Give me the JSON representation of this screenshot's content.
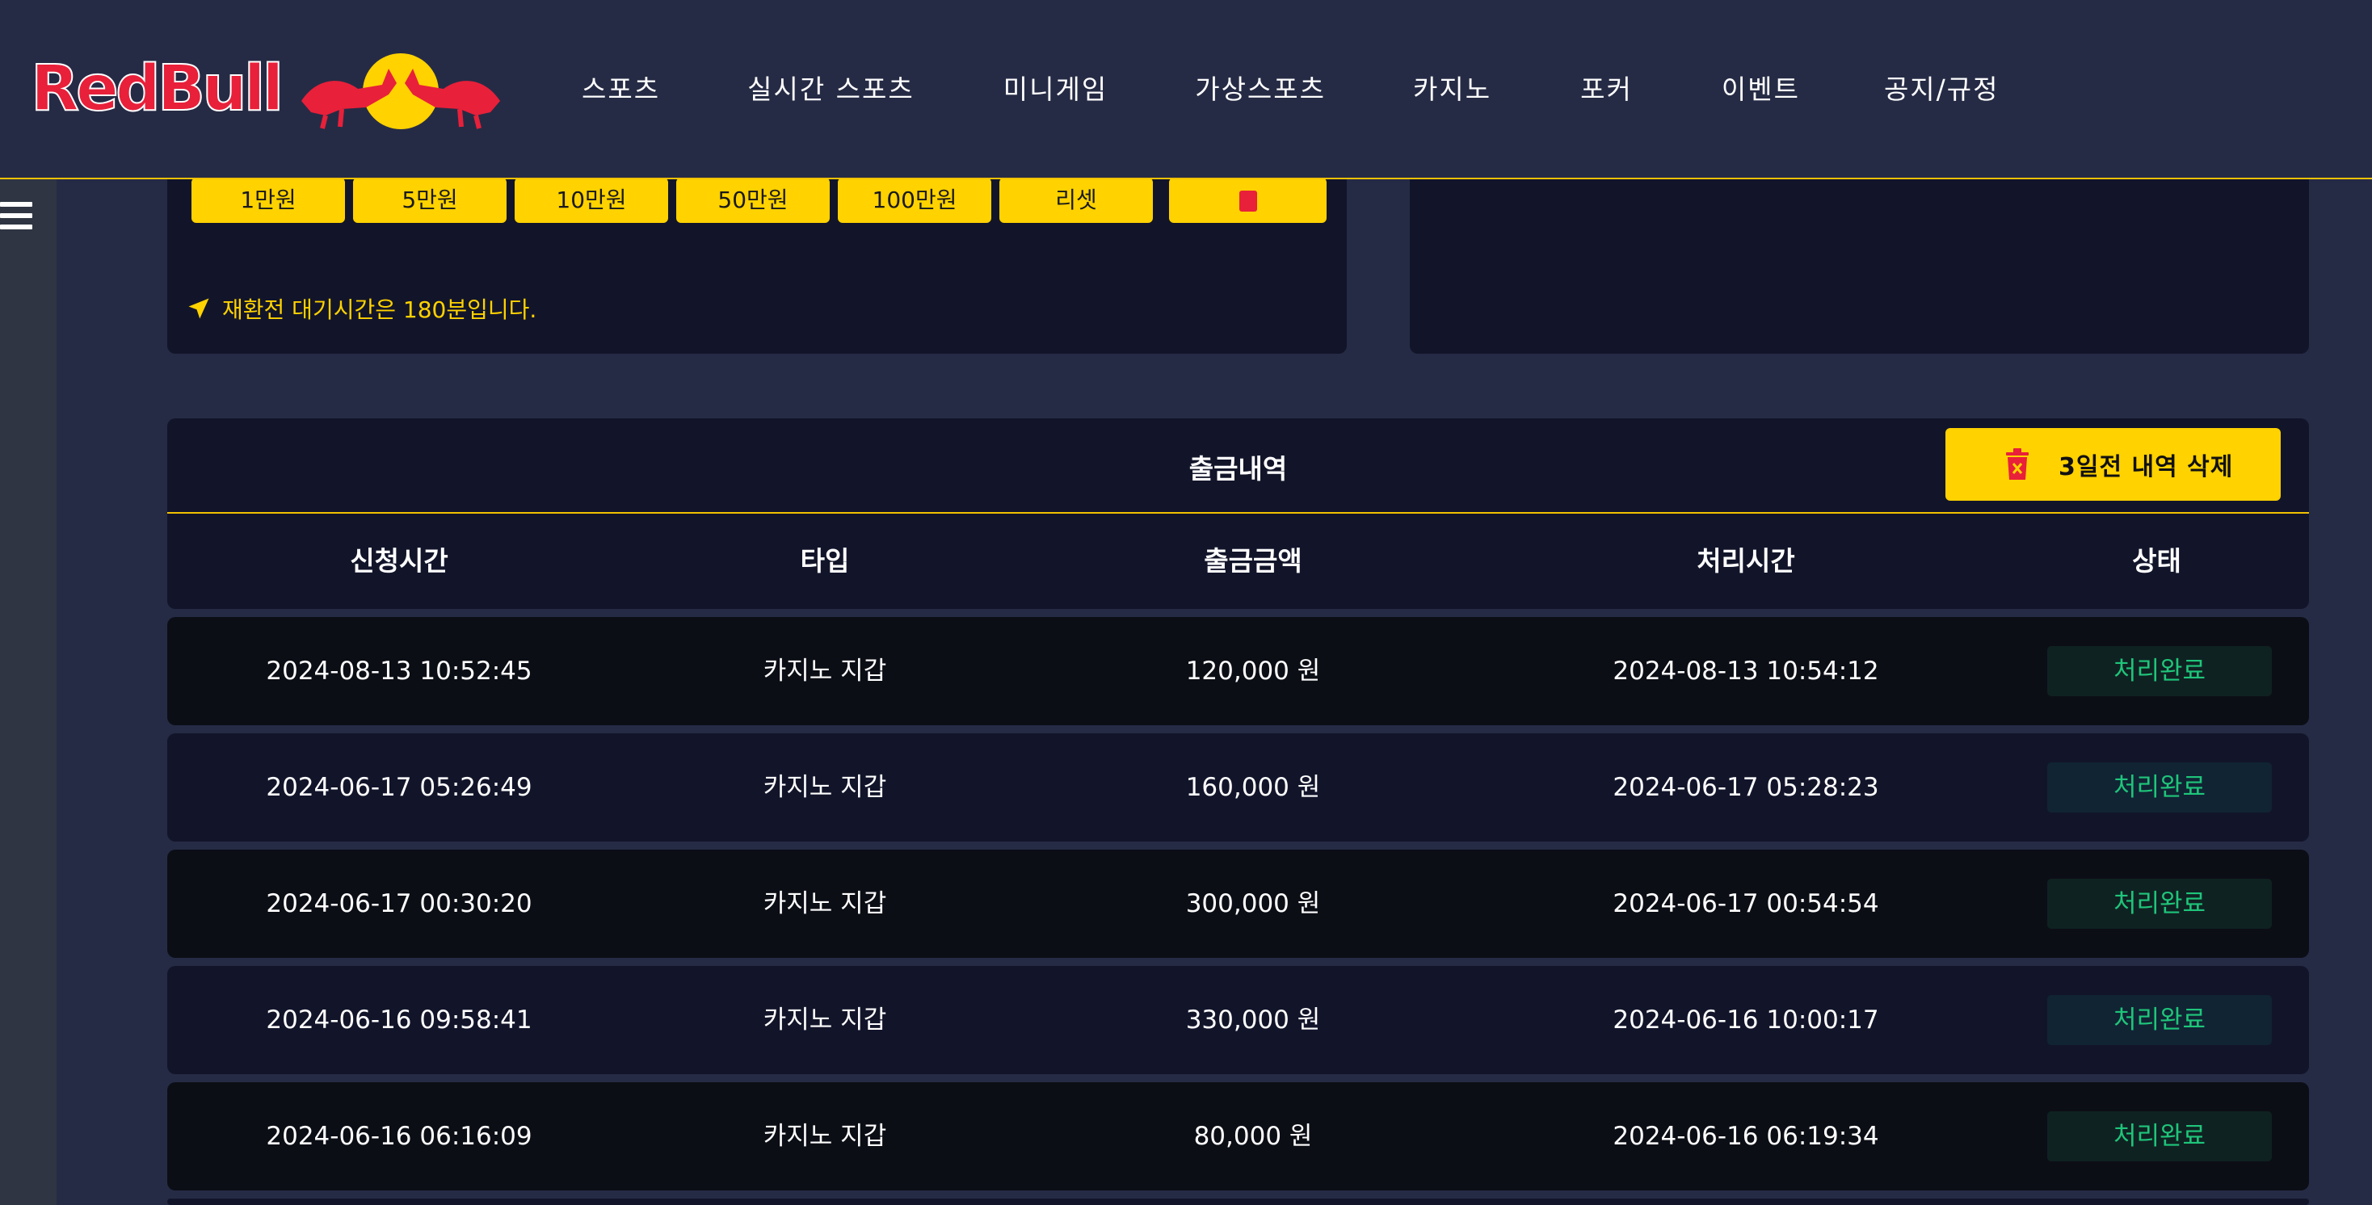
{
  "header": {
    "logo_text": "RedBull",
    "nav": [
      "스포츠",
      "실시간 스포츠",
      "미니게임",
      "가상스포츠",
      "카지노",
      "포커",
      "이벤트",
      "공지/규정"
    ]
  },
  "exchange_panel": {
    "amount_buttons": [
      "1만원",
      "5만원",
      "10만원",
      "50만원",
      "100만원",
      "리셋"
    ],
    "notice": "재환전 대기시간은 180분입니다."
  },
  "withdrawals": {
    "title": "출금내역",
    "delete_button_label": "3일전 내역 삭제",
    "columns": [
      "신청시간",
      "타입",
      "출금금액",
      "처리시간",
      "상태"
    ],
    "rows": [
      {
        "requested": "2024-08-13 10:52:45",
        "type": "카지노 지갑",
        "amount": "120,000 원",
        "processed": "2024-08-13 10:54:12",
        "status": "처리완료"
      },
      {
        "requested": "2024-06-17 05:26:49",
        "type": "카지노 지갑",
        "amount": "160,000 원",
        "processed": "2024-06-17 05:28:23",
        "status": "처리완료"
      },
      {
        "requested": "2024-06-17 00:30:20",
        "type": "카지노 지갑",
        "amount": "300,000 원",
        "processed": "2024-06-17 00:54:54",
        "status": "처리완료"
      },
      {
        "requested": "2024-06-16 09:58:41",
        "type": "카지노 지갑",
        "amount": "330,000 원",
        "processed": "2024-06-16 10:00:17",
        "status": "처리완료"
      },
      {
        "requested": "2024-06-16 06:16:09",
        "type": "카지노 지갑",
        "amount": "80,000 원",
        "processed": "2024-06-16 06:19:34",
        "status": "처리완료"
      }
    ]
  },
  "colors": {
    "accent": "#ffd200",
    "background": "#262b45",
    "panel": "#12152a",
    "status_text": "#1fc57a",
    "brand_red": "#e8203a"
  },
  "icons": [
    "redbull-logo-icon",
    "menu-icon",
    "paper-plane-icon",
    "trash-icon"
  ]
}
